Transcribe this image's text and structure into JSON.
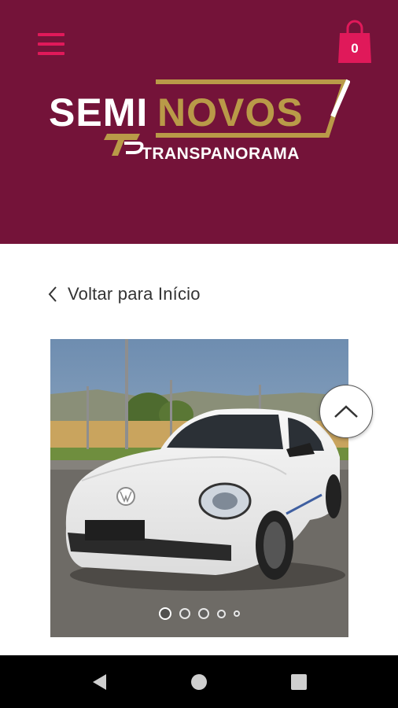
{
  "header": {
    "menu_icon": "hamburger-menu-icon",
    "cart": {
      "icon": "shopping-bag-icon",
      "count": "0"
    },
    "logo": {
      "line1_white": "SEMI",
      "line1_gold": "NOVOS",
      "monogram": "TP",
      "line2": "TRANSPANORAMA"
    }
  },
  "main": {
    "back_link": {
      "icon": "chevron-left-icon",
      "label": "Voltar para Início"
    },
    "gallery": {
      "image_icon": "car-photo",
      "slide_count": 5,
      "active_slide": 1
    },
    "scroll_top": {
      "icon": "chevron-up-icon"
    }
  },
  "system_nav": {
    "back": "triangle-back-icon",
    "home": "circle-home-icon",
    "recents": "square-recents-icon"
  },
  "colors": {
    "brand": "#741339",
    "accent_pink": "#e0195a",
    "gold": "#b99a48",
    "navbar": "#000000"
  }
}
